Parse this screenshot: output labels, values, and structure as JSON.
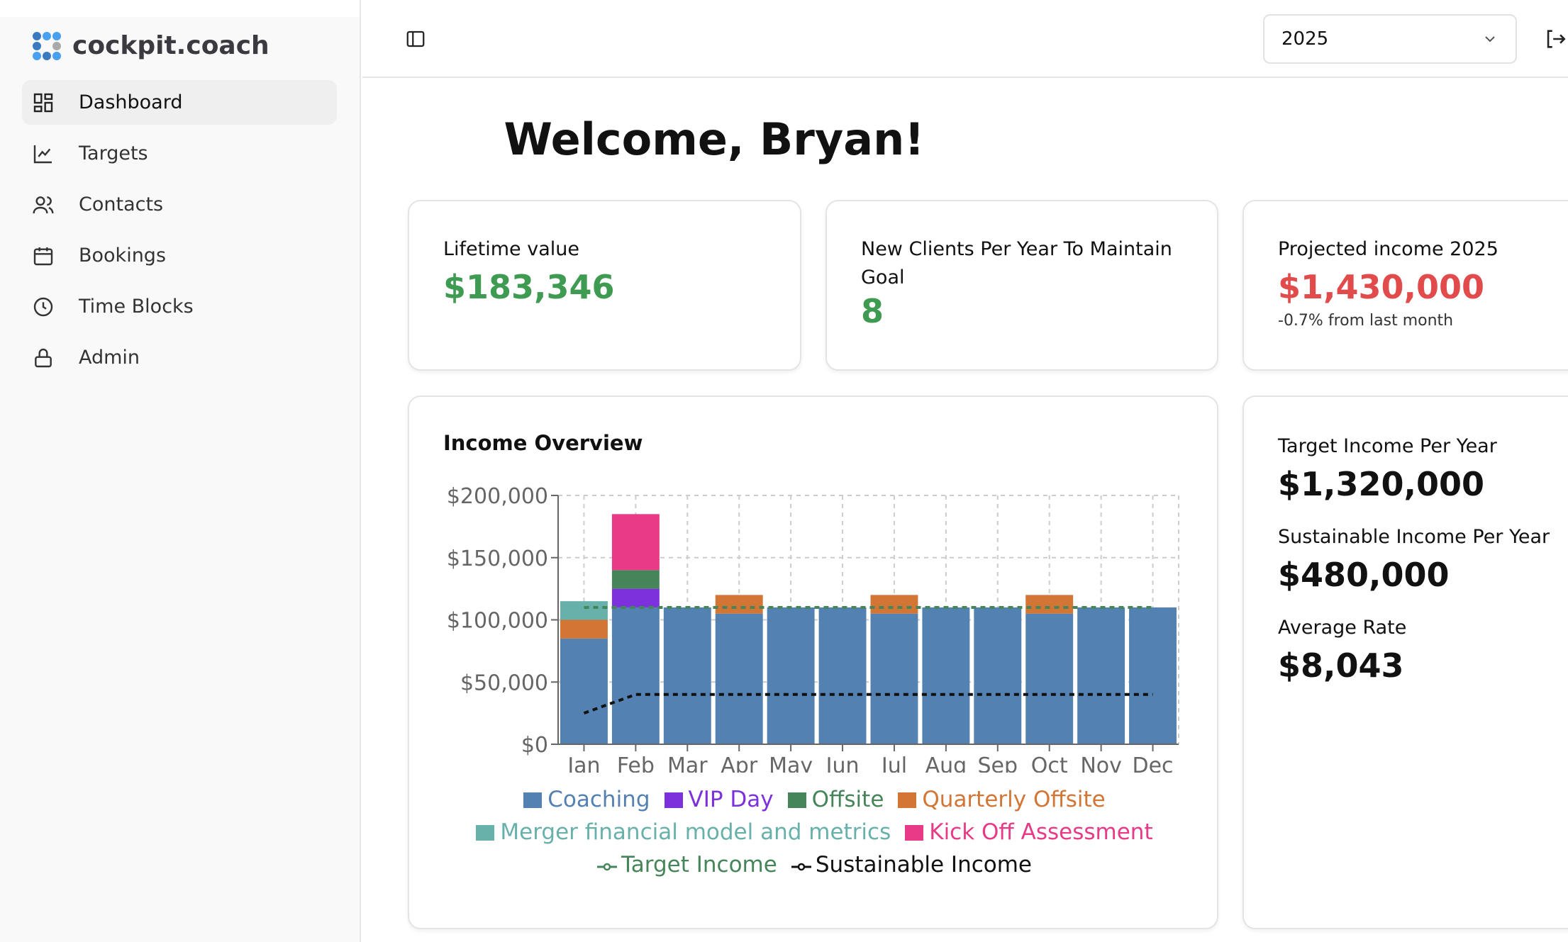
{
  "brand": {
    "name": "cockpit.coach"
  },
  "sidebar": {
    "items": [
      {
        "label": "Dashboard",
        "icon": "dashboard-icon",
        "active": true
      },
      {
        "label": "Targets",
        "icon": "line-chart-icon"
      },
      {
        "label": "Contacts",
        "icon": "users-icon"
      },
      {
        "label": "Bookings",
        "icon": "calendar-icon"
      },
      {
        "label": "Time Blocks",
        "icon": "clock-icon"
      },
      {
        "label": "Admin",
        "icon": "lock-icon"
      }
    ]
  },
  "header": {
    "year": "2025"
  },
  "welcome": "Welcome, Bryan!",
  "cards": {
    "lifetime": {
      "label": "Lifetime value",
      "value": "$183,346"
    },
    "new_clients": {
      "label": "New Clients Per Year To Maintain Goal",
      "value": "8"
    },
    "projected": {
      "label": "Projected income 2025",
      "value": "$1,430,000",
      "sub": "-0.7% from last month"
    }
  },
  "stats": {
    "target": {
      "label": "Target Income Per Year",
      "value": "$1,320,000"
    },
    "sustainable": {
      "label": "Sustainable Income Per Year",
      "value": "$480,000"
    },
    "rate": {
      "label": "Average Rate",
      "value": "$8,043"
    }
  },
  "chart_data": {
    "type": "bar",
    "title": "Income Overview",
    "stacked": true,
    "categories": [
      "Jan",
      "Feb",
      "Mar",
      "Apr",
      "May",
      "Jun",
      "Jul",
      "Aug",
      "Sep",
      "Oct",
      "Nov",
      "Dec"
    ],
    "ylim": [
      0,
      200000
    ],
    "yticks": [
      "$0",
      "$50,000",
      "$100,000",
      "$150,000",
      "$200,000"
    ],
    "grid": true,
    "legend": "bottom",
    "series": [
      {
        "name": "Coaching",
        "color": "#5381b1",
        "values": [
          85000,
          110000,
          110000,
          105000,
          110000,
          110000,
          105000,
          110000,
          110000,
          105000,
          110000,
          110000
        ]
      },
      {
        "name": "VIP Day",
        "color": "#7c31dc",
        "values": [
          0,
          15000,
          0,
          0,
          0,
          0,
          0,
          0,
          0,
          0,
          0,
          0
        ]
      },
      {
        "name": "Offsite",
        "color": "#468559",
        "values": [
          0,
          15000,
          0,
          0,
          0,
          0,
          0,
          0,
          0,
          0,
          0,
          0
        ]
      },
      {
        "name": "Quarterly Offsite",
        "color": "#d27535",
        "values": [
          15000,
          0,
          0,
          15000,
          0,
          0,
          15000,
          0,
          0,
          15000,
          0,
          0
        ]
      },
      {
        "name": "Merger financial model and metrics",
        "color": "#68b0aa",
        "values": [
          15000,
          0,
          0,
          0,
          0,
          0,
          0,
          0,
          0,
          0,
          0,
          0
        ]
      },
      {
        "name": "Kick Off Assessment",
        "color": "#e83a86",
        "values": [
          0,
          45000,
          0,
          0,
          0,
          0,
          0,
          0,
          0,
          0,
          0,
          0
        ]
      }
    ],
    "lines": [
      {
        "name": "Target Income",
        "color": "#468559",
        "values": [
          110000,
          110000,
          110000,
          110000,
          110000,
          110000,
          110000,
          110000,
          110000,
          110000,
          110000,
          110000
        ]
      },
      {
        "name": "Sustainable Income",
        "color": "#111111",
        "values": [
          25000,
          40000,
          40000,
          40000,
          40000,
          40000,
          40000,
          40000,
          40000,
          40000,
          40000,
          40000
        ]
      }
    ]
  }
}
